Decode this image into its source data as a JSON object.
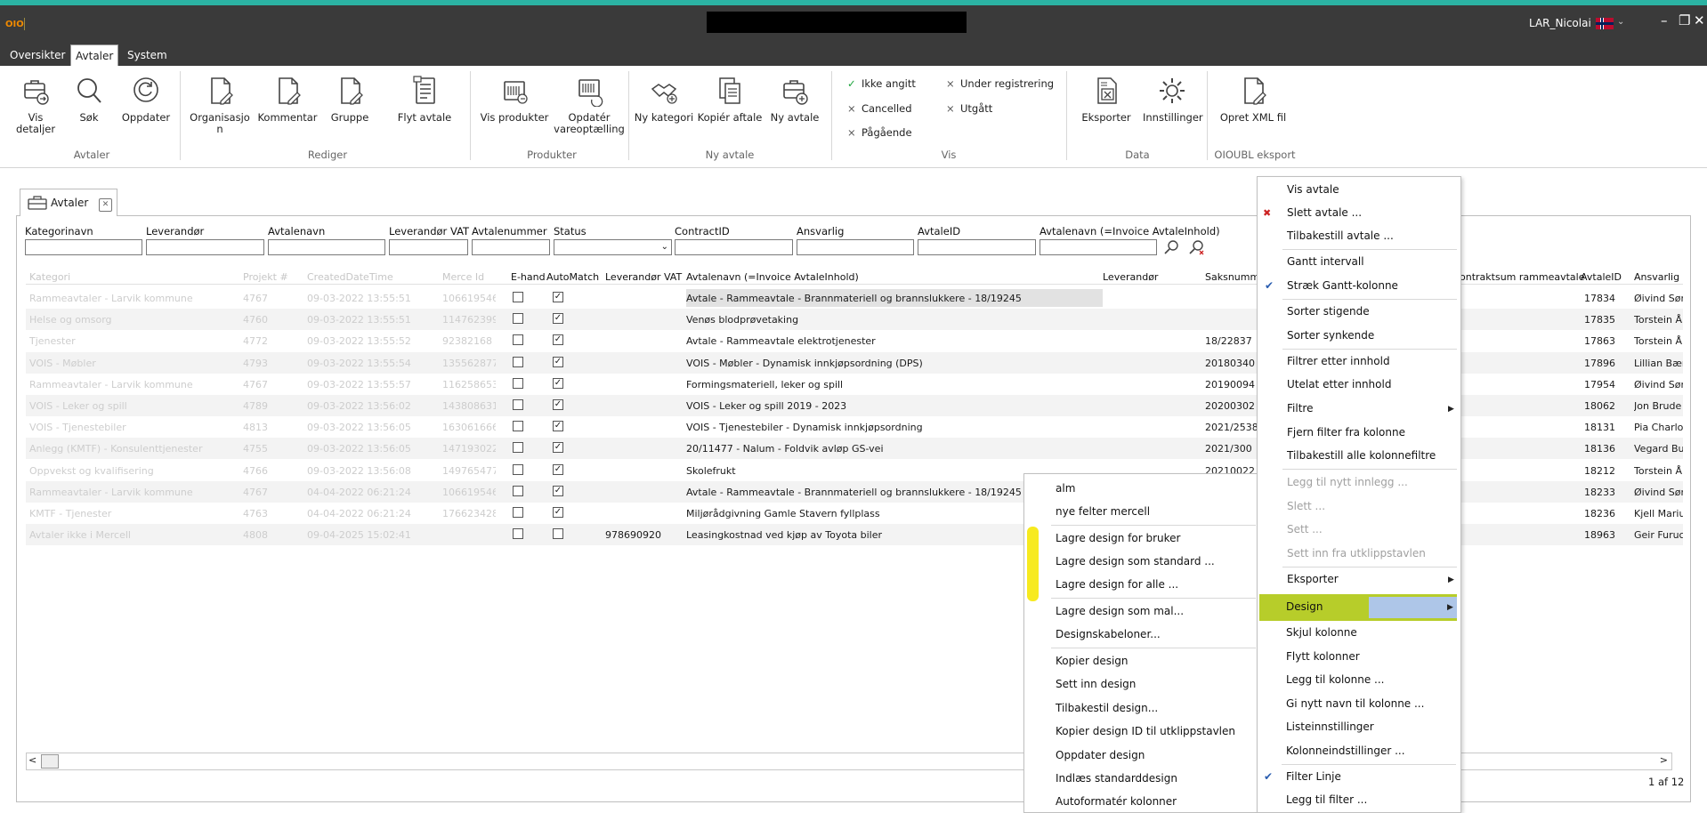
{
  "window": {
    "app_logo": "OIO",
    "user": "LAR_Nicolai",
    "minimize": "–",
    "restore": "❐",
    "close": "✕"
  },
  "menu_tabs": [
    "Oversikter",
    "Avtaler",
    "System"
  ],
  "ribbon": {
    "avtaler": {
      "label": "Avtaler",
      "vis_detaljer": "Vis detaljer",
      "sok": "Søk",
      "oppdater": "Oppdater"
    },
    "rediger": {
      "label": "Rediger",
      "organisasjon_1": "Organisasjo",
      "organisasjon_2": "n",
      "kommentar": "Kommentar",
      "gruppe": "Gruppe",
      "flyt_avtale": "Flyt avtale"
    },
    "produkter": {
      "label": "Produkter",
      "vis_produkter": "Vis produkter",
      "opdater_1": "Opdatér",
      "opdater_2": "vareoptælling"
    },
    "ny_avtale": {
      "label": "Ny avtale",
      "ny_kategori": "Ny kategori",
      "kopier_aftale": "Kopiér aftale",
      "ny_avtale": "Ny avtale"
    },
    "vis": {
      "label": "Vis",
      "ikke_angitt": "Ikke angitt",
      "cancelled": "Cancelled",
      "pagaende": "Pågående",
      "under_registrering": "Under registrering",
      "utgatt": "Utgått"
    },
    "data": {
      "label": "Data",
      "eksporter": "Eksporter",
      "innstillinger": "Innstillinger"
    },
    "oioubl": {
      "label": "OIOUBL eksport",
      "opret_xml": "Opret XML fil"
    }
  },
  "panel_tab": "Avtaler",
  "filters": [
    "Kategorinavn",
    "Leverandør",
    "Avtalenavn",
    "Leverandør VAT",
    "Avtalenummer",
    "Status",
    "ContractID",
    "Ansvarlig",
    "AvtaleID",
    "Avtalenavn (=Invoice AvtaleInhold)"
  ],
  "columns": {
    "faded": [
      "Kategori",
      "Projekt #",
      "CreatedDateTime",
      "Merce Id"
    ],
    "main": [
      "E-hand",
      "AutoMatch",
      "Leverandør VAT",
      "Avtalenavn (=Invoice AvtaleInhold)",
      "Leverandør",
      "Saksnumm",
      "ontraktsum rammeavtale",
      "AvtaleID",
      "Ansvarlig"
    ]
  },
  "rows": [
    {
      "kategori": "Rammeavtaler - Larvik kommune",
      "projekt": "4767",
      "created": "09-03-2022 13:55:51",
      "merce": "106619546",
      "ehand": false,
      "auto": true,
      "vat": "",
      "navn": "Avtale - Rammeavtale - Brannmateriell og brannslukkere - 18/19245",
      "saks": "",
      "avtaleid": "17834",
      "ansvarlig": "Øivind Sør"
    },
    {
      "kategori": "Helse og omsorg",
      "projekt": "4760",
      "created": "09-03-2022 13:55:51",
      "merce": "114762399",
      "ehand": false,
      "auto": true,
      "vat": "",
      "navn": "Venøs blodprøvetaking",
      "saks": "",
      "avtaleid": "17835",
      "ansvarlig": "Torstein Å"
    },
    {
      "kategori": "Tjenester",
      "projekt": "4772",
      "created": "09-03-2022 13:55:52",
      "merce": "92382168",
      "ehand": false,
      "auto": true,
      "vat": "",
      "navn": "Avtale - Rammeavtale elektrotjenester",
      "saks": "18/22837",
      "avtaleid": "17863",
      "ansvarlig": "Torstein Å"
    },
    {
      "kategori": "VOIS - Møbler",
      "projekt": "4793",
      "created": "09-03-2022 13:55:54",
      "merce": "135562877",
      "ehand": false,
      "auto": true,
      "vat": "",
      "navn": "VOIS - Møbler - Dynamisk innkjøpsordning (DPS)",
      "saks": "20180340",
      "avtaleid": "17896",
      "ansvarlig": "Lillian Bær"
    },
    {
      "kategori": "Rammeavtaler - Larvik kommune",
      "projekt": "4767",
      "created": "09-03-2022 13:55:57",
      "merce": "116258653",
      "ehand": false,
      "auto": true,
      "vat": "",
      "navn": "Formingsmateriell, leker og spill",
      "saks": "20190094",
      "avtaleid": "17954",
      "ansvarlig": "Øivind Sør"
    },
    {
      "kategori": "VOIS - Leker og spill",
      "projekt": "4789",
      "created": "09-03-2022 13:56:02",
      "merce": "143808631",
      "ehand": false,
      "auto": true,
      "vat": "",
      "navn": "VOIS - Leker og spill 2019 - 2023",
      "saks": "20200302",
      "avtaleid": "18062",
      "ansvarlig": "Jon Brude"
    },
    {
      "kategori": "VOIS - Tjenestebiler",
      "projekt": "4813",
      "created": "09-03-2022 13:56:05",
      "merce": "163061666",
      "ehand": false,
      "auto": true,
      "vat": "",
      "navn": "VOIS - Tjenestebiler - Dynamisk innkjøpsordning",
      "saks": "2021/2538",
      "avtaleid": "18131",
      "ansvarlig": "Pia Charlo"
    },
    {
      "kategori": "Anlegg (KMTF) - Konsulenttjenester",
      "projekt": "4755",
      "created": "09-03-2022 13:56:05",
      "merce": "147193022",
      "ehand": false,
      "auto": true,
      "vat": "",
      "navn": "20/11477 - Nalum - Foldvik avløp GS-vei",
      "saks": "2021/300",
      "avtaleid": "18136",
      "ansvarlig": "Vegard Bu"
    },
    {
      "kategori": "Oppvekst og kvalifisering",
      "projekt": "4766",
      "created": "09-03-2022 13:56:08",
      "merce": "149765477",
      "ehand": false,
      "auto": true,
      "vat": "",
      "navn": "Skolefrukt",
      "saks": "20210022",
      "avtaleid": "18212",
      "ansvarlig": "Torstein Å"
    },
    {
      "kategori": "Rammeavtaler - Larvik kommune",
      "projekt": "4767",
      "created": "04-04-2022 06:21:24",
      "merce": "106619546",
      "ehand": false,
      "auto": true,
      "vat": "",
      "navn": "Avtale - Rammeavtale - Brannmateriell og brannslukkere - 18/19245",
      "saks": "",
      "avtaleid": "18233",
      "ansvarlig": "Øivind Sør"
    },
    {
      "kategori": "KMTF - Tjenester",
      "projekt": "4763",
      "created": "04-04-2022 06:21:24",
      "merce": "176623428",
      "ehand": false,
      "auto": true,
      "vat": "",
      "navn": "Miljørådgivning Gamle Stavern fyllplass",
      "saks": "",
      "avtaleid": "18236",
      "ansvarlig": "Kjell Mariu"
    },
    {
      "kategori": "Avtaler ikke i Mercell",
      "projekt": "4808",
      "created": "09-04-2025 15:02:41",
      "merce": "",
      "ehand": false,
      "auto": false,
      "vat": "978690920",
      "navn": "Leasingkostnad ved kjøp av Toyota biler",
      "saks": "",
      "avtaleid": "18963",
      "ansvarlig": "Geir Furuc"
    }
  ],
  "paging": "1 af 12",
  "context_menu": {
    "vis_avtale": "Vis avtale",
    "slett_avtale": "Slett avtale ...",
    "tilbakestill_avtale": "Tilbakestill avtale ...",
    "gantt_intervall": "Gantt intervall",
    "straek_gantt": "Stræk Gantt-kolonne",
    "sorter_stigende": "Sorter stigende",
    "sorter_synkende": "Sorter synkende",
    "filtrer_innhold": "Filtrer etter innhold",
    "utelat_innhold": "Utelat etter innhold",
    "filtre": "Filtre",
    "fjern_filter": "Fjern filter fra kolonne",
    "tilbakestill_filtre": "Tilbakestill alle kolonnefiltre",
    "legg_til_innlegg": "Legg til nytt innlegg ...",
    "slett": "Slett ...",
    "sett": "Sett ...",
    "sett_inn_utklipp": "Sett inn fra utklippstavlen",
    "eksporter": "Eksporter",
    "design": "Design",
    "skjul_kolonne": "Skjul kolonne",
    "flytt_kolonner": "Flytt kolonner",
    "legg_til_kolonne": "Legg til kolonne ...",
    "gi_nytt_navn": "Gi nytt navn til kolonne ...",
    "listeinnstillinger": "Listeinnstillinger",
    "kolonneinnstillinger": "Kolonneindstillinger ...",
    "filter_linje": "Filter Linje",
    "legg_til_filter": "Legg til filter ..."
  },
  "design_submenu": {
    "alm": "alm",
    "nye_felter": "nye felter mercell",
    "lagre_bruker": "Lagre design for bruker",
    "lagre_standard": "Lagre design som standard ...",
    "lagre_alle": "Lagre design for alle ...",
    "lagre_mal": "Lagre design som mal...",
    "designskabeloner": "Designskabeloner...",
    "kopier_design": "Kopier design",
    "sett_inn_design": "Sett inn design",
    "tilbakestil_design": "Tilbakestil design...",
    "kopier_id": "Kopier design ID til utklippstavlen",
    "oppdater_design": "Oppdater design",
    "indlaes": "Indlæs standarddesign",
    "autoformater": "Autoformatér kolonner"
  },
  "colors": {
    "highlight_green": "#b7cd2a",
    "highlight_blue": "#aec6e8",
    "yellow_mark": "#f7ea1f",
    "title_bar": "#3a3a3a"
  }
}
